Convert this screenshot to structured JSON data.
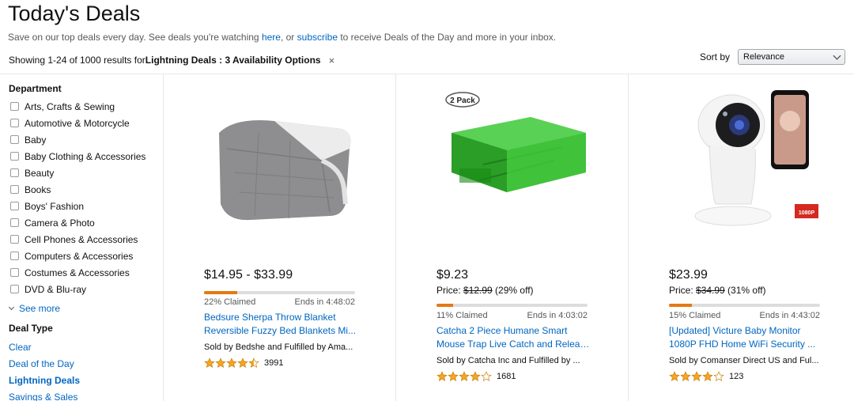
{
  "header": {
    "title": "Today's Deals",
    "intro_pre": "Save on our top deals every day. See deals you're watching ",
    "intro_link1": "here",
    "intro_mid": ", or ",
    "intro_link2": "subscribe",
    "intro_post": " to receive Deals of the Day and more in your inbox."
  },
  "results": {
    "prefix": "Showing 1-24 of 1000 results for ",
    "filter": "Lightning Deals : 3 Availability Options",
    "clear_icon": "×"
  },
  "sort": {
    "label": "Sort by",
    "selected": "Relevance"
  },
  "sidebar": {
    "department_heading": "Department",
    "departments": [
      "Arts, Crafts & Sewing",
      "Automotive & Motorcycle",
      "Baby",
      "Baby Clothing & Accessories",
      "Beauty",
      "Books",
      "Boys' Fashion",
      "Camera & Photo",
      "Cell Phones & Accessories",
      "Computers & Accessories",
      "Costumes & Accessories",
      "DVD & Blu-ray"
    ],
    "see_more": "See more",
    "deal_type_heading": "Deal Type",
    "deal_types": [
      "Clear",
      "Deal of the Day",
      "Lightning Deals",
      "Savings & Sales"
    ]
  },
  "products": [
    {
      "price": "$14.95 - $33.99",
      "claimed_pct": 22,
      "claimed": "22% Claimed",
      "ends": "Ends in 4:48:02",
      "title_line1": "Bedsure Sherpa Throw Blanket",
      "title_line2": "Reversible Fuzzy Bed Blankets Mi...",
      "seller": "Sold by Bedshe and Fulfilled by Ama...",
      "stars": 4.5,
      "reviews": "3991"
    },
    {
      "price": "$9.23",
      "price_prefix": "Price: ",
      "list_price": "$12.99",
      "discount": " (29% off)",
      "claimed_pct": 11,
      "claimed": "11% Claimed",
      "ends": "Ends in 4:03:02",
      "badge": "2 Pack",
      "title_line1": "Catcha 2 Piece Humane Smart",
      "title_line2": "Mouse Trap Live Catch and Releas...",
      "seller": "Sold by Catcha Inc and Fulfilled by ...",
      "stars": 4.0,
      "reviews": "1681"
    },
    {
      "price": "$23.99",
      "price_prefix": "Price: ",
      "list_price": "$34.99",
      "discount": " (31% off)",
      "claimed_pct": 15,
      "claimed": "15% Claimed",
      "ends": "Ends in 4:43:02",
      "logo": "1080P",
      "title_line1": "[Updated] Victure Baby Monitor",
      "title_line2": "1080P FHD Home WiFi Security ...",
      "seller": "Sold by Comanser Direct US and Ful...",
      "stars": 4.0,
      "reviews": "123"
    }
  ],
  "colors": {
    "link": "#0066c0",
    "claim_bar": "#e47911",
    "star": "#f5a623"
  }
}
